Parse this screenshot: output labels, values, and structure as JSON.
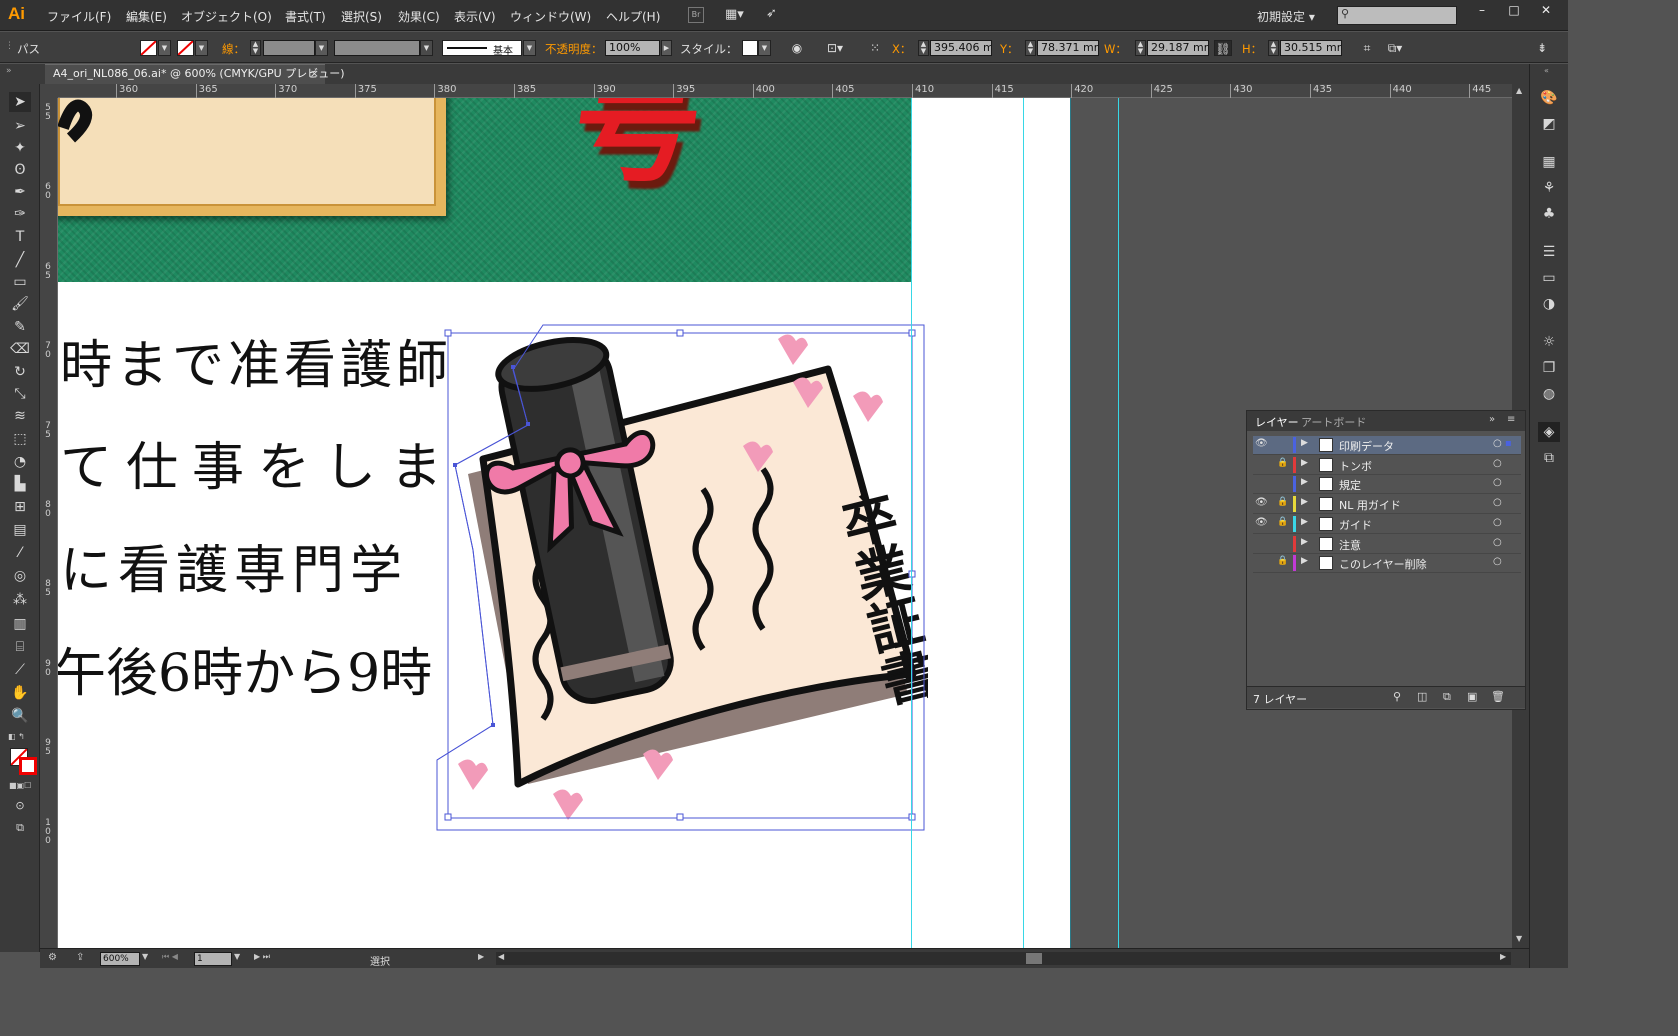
{
  "app": {
    "logo": "Ai"
  },
  "menu": [
    "ファイル(F)",
    "編集(E)",
    "オブジェクト(O)",
    "書式(T)",
    "選択(S)",
    "効果(C)",
    "表示(V)",
    "ウィンドウ(W)",
    "ヘルプ(H)"
  ],
  "workspace": {
    "label": "初期設定"
  },
  "window_buttons": [
    "–",
    "□",
    "✕"
  ],
  "control": {
    "object_type": "パス",
    "stroke_label": "線：",
    "stroke_profile": "基本",
    "opacity_label": "不透明度：",
    "opacity_value": "100%",
    "style_label": "スタイル：",
    "x_label": "X：",
    "x_value": "395.406 mr",
    "y_label": "Y：",
    "y_value": "78.371 mr",
    "w_label": "W：",
    "w_value": "29.187 mr",
    "h_label": "H：",
    "h_value": "30.515 mr"
  },
  "document_tab": {
    "title": "A4_ori_NL086_06.ai* @ 600% (CMYK/GPU プレビュー)",
    "close": "×"
  },
  "ruler": {
    "h_ticks": [
      "360",
      "365",
      "370",
      "375",
      "380",
      "385",
      "390",
      "395",
      "400",
      "405",
      "410",
      "415",
      "420",
      "425",
      "430",
      "435",
      "440",
      "445"
    ],
    "v_ticks": [
      "5 5",
      "6 0",
      "6 5",
      "7 0",
      "7 5",
      "8 0",
      "8 5",
      "9 0",
      "9 5",
      "1 0 0"
    ]
  },
  "artwork": {
    "heading_char": "号",
    "body_lines": [
      "時まで准看護師",
      "て仕事をしま",
      "に看護専門学",
      "午後6時から9時"
    ],
    "illustration_text": "卒業証書",
    "colors": {
      "green_band": "#1f8a60",
      "heading_red": "#e51c23",
      "selection": "#4a55d6",
      "guide": "#37d7e6"
    }
  },
  "layers_panel": {
    "tabs": [
      "レイヤー",
      "アートボード"
    ],
    "layers": [
      {
        "name": "印刷データ",
        "visible": true,
        "locked": false,
        "color": "#4a62e0",
        "selected": true
      },
      {
        "name": "トンボ",
        "visible": false,
        "locked": true,
        "color": "#e03a3a",
        "selected": false
      },
      {
        "name": "規定",
        "visible": false,
        "locked": false,
        "color": "#4a62e0",
        "selected": false
      },
      {
        "name": "NL 用ガイド",
        "visible": true,
        "locked": true,
        "color": "#e7d93a",
        "selected": false
      },
      {
        "name": "ガイド",
        "visible": true,
        "locked": true,
        "color": "#3ad6e6",
        "selected": false
      },
      {
        "name": "注意",
        "visible": false,
        "locked": false,
        "color": "#e03a3a",
        "selected": false
      },
      {
        "name": "このレイヤー削除",
        "visible": false,
        "locked": true,
        "color": "#c23ad6",
        "selected": false
      }
    ],
    "count_label": "7 レイヤー"
  },
  "status": {
    "zoom": "600%",
    "artboard": "1",
    "tool": "選択"
  }
}
